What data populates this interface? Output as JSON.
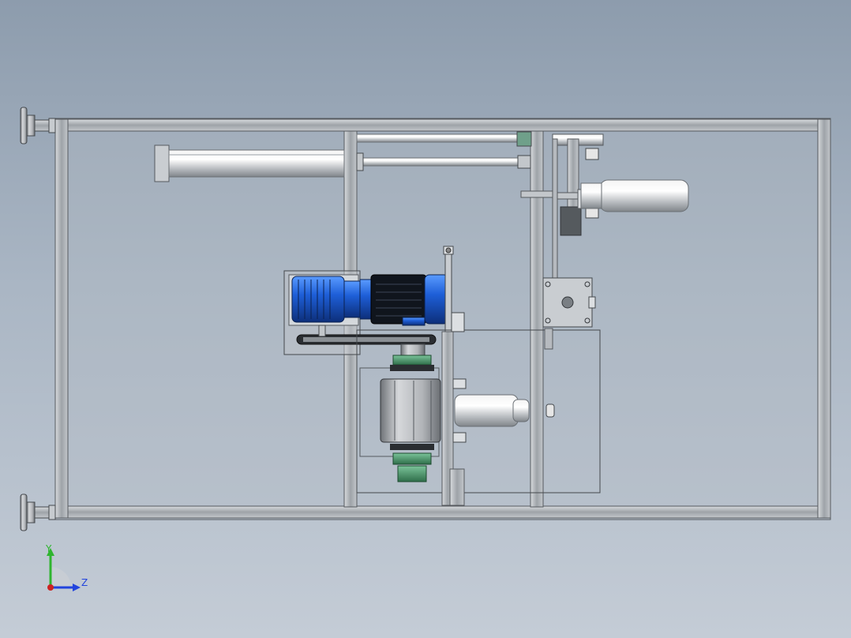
{
  "view": {
    "type": "cad-viewport",
    "background_top": "#8d9cad",
    "background_bottom": "#c4ccd6",
    "frame_color": "#a4a9ae",
    "motor_color": "#1e5fd8",
    "sprocket_color": "#3e8a5f"
  },
  "triad": {
    "y_label": "Y",
    "z_label": "Z",
    "y_color": "#2fb52f",
    "z_color": "#2244dd",
    "x_color": "#cc2222"
  },
  "components": [
    {
      "name": "frame",
      "icon": "frame-icon"
    },
    {
      "name": "motor",
      "icon": "motor-icon"
    },
    {
      "name": "gearbox",
      "icon": "gearbox-icon"
    },
    {
      "name": "chain-drive",
      "icon": "chain-icon"
    },
    {
      "name": "pneumatic-cylinder",
      "icon": "cylinder-icon"
    },
    {
      "name": "leveling-feet",
      "icon": "foot-icon"
    }
  ]
}
